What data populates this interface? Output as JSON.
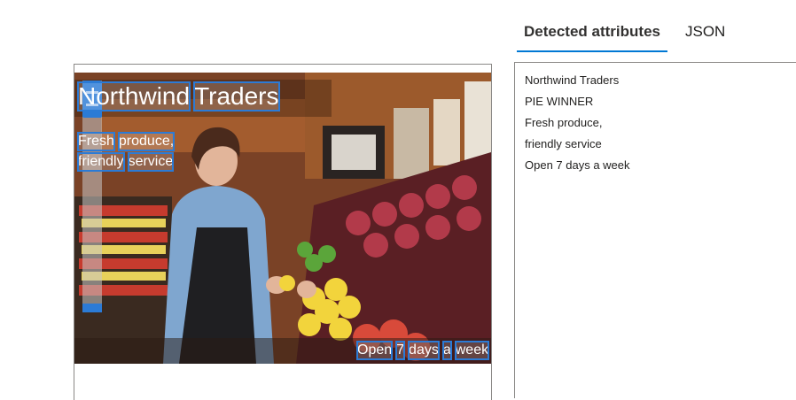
{
  "tabs": [
    {
      "label": "Detected attributes",
      "active": true
    },
    {
      "label": "JSON",
      "active": false
    }
  ],
  "image": {
    "description_icon": "photo-grocery-worker",
    "ocr_lines": [
      {
        "words": [
          "Northwind",
          "Traders"
        ]
      },
      {
        "words": [
          "Fresh",
          "produce,"
        ]
      },
      {
        "words": [
          "friendly",
          "service"
        ]
      },
      {
        "words": [
          "Open",
          "7",
          "days",
          "a",
          "week"
        ]
      }
    ]
  },
  "attributes": [
    "Northwind Traders",
    "PIE WINNER",
    "Fresh produce,",
    "friendly service",
    "Open 7 days a week"
  ],
  "colors": {
    "accent": "#0078d4",
    "box": "#2b7bd6",
    "border": "#8a8886"
  }
}
